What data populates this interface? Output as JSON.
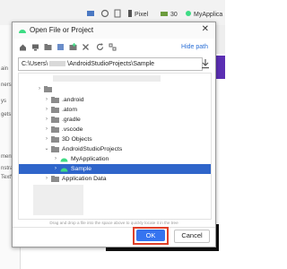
{
  "ide": {
    "device_label": "Pixel",
    "api_label": "30",
    "app_label": "MyApplica",
    "left_panel_texts": [
      "ain",
      "ners",
      "ys",
      "gets",
      "ment Tr",
      "nstrai",
      "TextV"
    ]
  },
  "dialog": {
    "title": "Open File or Project",
    "hide_path_label": "Hide path",
    "path_prefix": "C:\\Users\\",
    "path_suffix": "\\AndroidStudioProjects\\Sample",
    "hint": "Drag and drop a file into the space above to quickly locate it in the tree",
    "ok_label": "OK",
    "cancel_label": "Cancel"
  },
  "tree": {
    "rows": [
      {
        "label": ".android"
      },
      {
        "label": ".atom"
      },
      {
        "label": ".gradle"
      },
      {
        "label": ".vscode"
      },
      {
        "label": "3D Objects"
      },
      {
        "label": "AndroidStudioProjects"
      },
      {
        "label": "MyApplication"
      },
      {
        "label": "Sample"
      },
      {
        "label": "Application Data"
      }
    ],
    "selected": "Sample"
  },
  "colors": {
    "selection": "#2f65ca",
    "ok_button": "#3574f0",
    "highlight": "#e0402a",
    "folder": "#8c8c8c",
    "android_green": "#3ddc84",
    "link": "#2a6fd6"
  }
}
